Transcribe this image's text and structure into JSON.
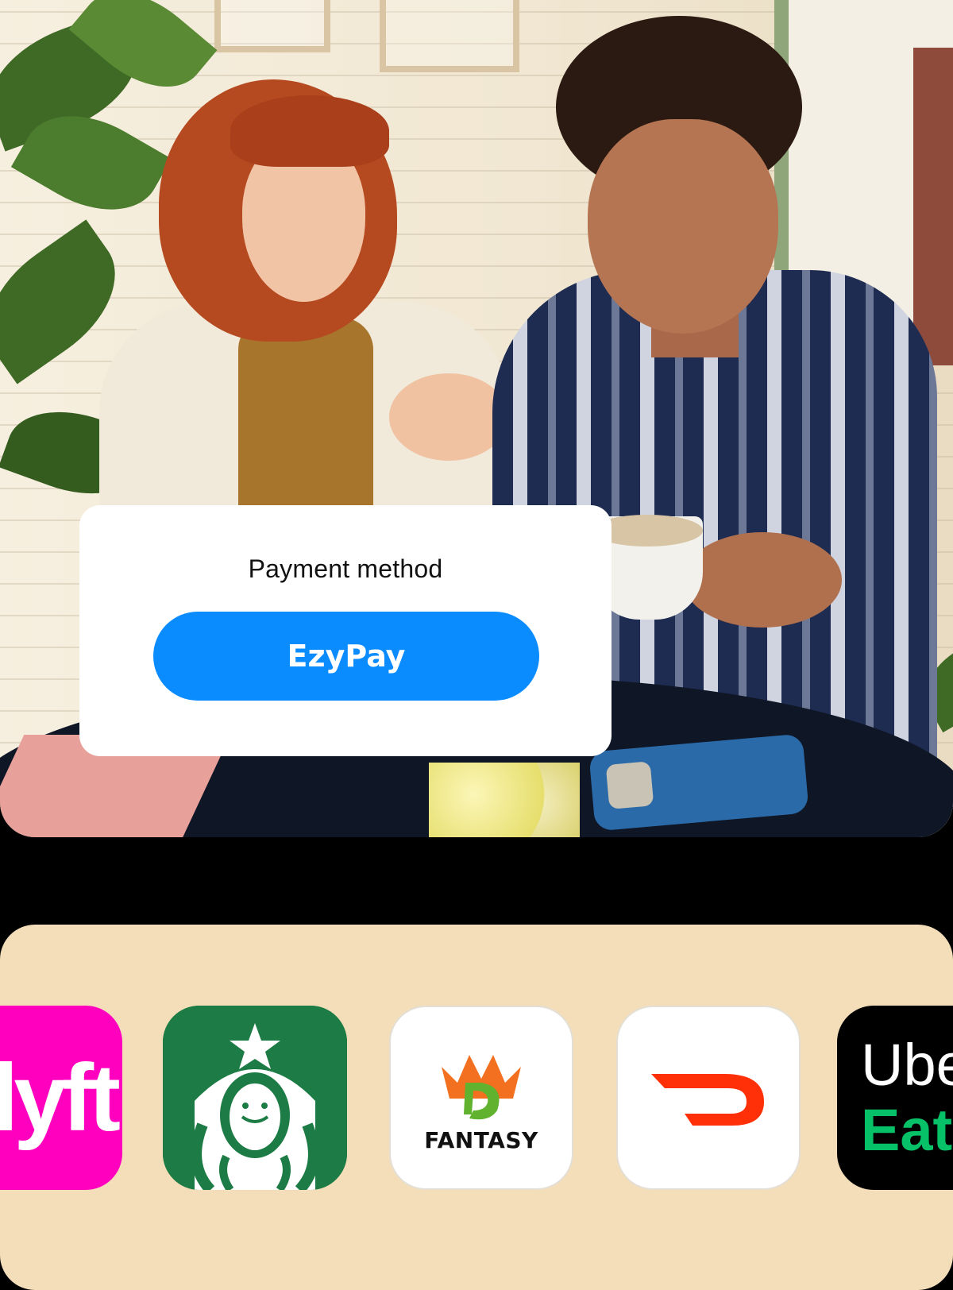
{
  "hero": {
    "image_alt_name": "people-at-cafe-photo"
  },
  "payment_card": {
    "title": "Payment method",
    "button_label": "EzyPay",
    "button_color": "#0a8cff"
  },
  "app_tray": {
    "background_color": "#f4deba",
    "apps": [
      {
        "name": "lyft",
        "text": "lyft",
        "color": "#ff00bf",
        "icon": "lyft-icon"
      },
      {
        "name": "starbucks",
        "color": "#1d7c45",
        "icon": "starbucks-siren-icon"
      },
      {
        "name": "fantasy",
        "text": "FANTASY",
        "color": "#ffffff",
        "icon": "draftkings-fantasy-icon"
      },
      {
        "name": "doordash",
        "color": "#ffffff",
        "icon": "doordash-icon"
      },
      {
        "name": "ubereats",
        "line1": "Ube",
        "line2": "Eat",
        "color": "#000000",
        "icon": "uber-eats-icon"
      }
    ]
  }
}
